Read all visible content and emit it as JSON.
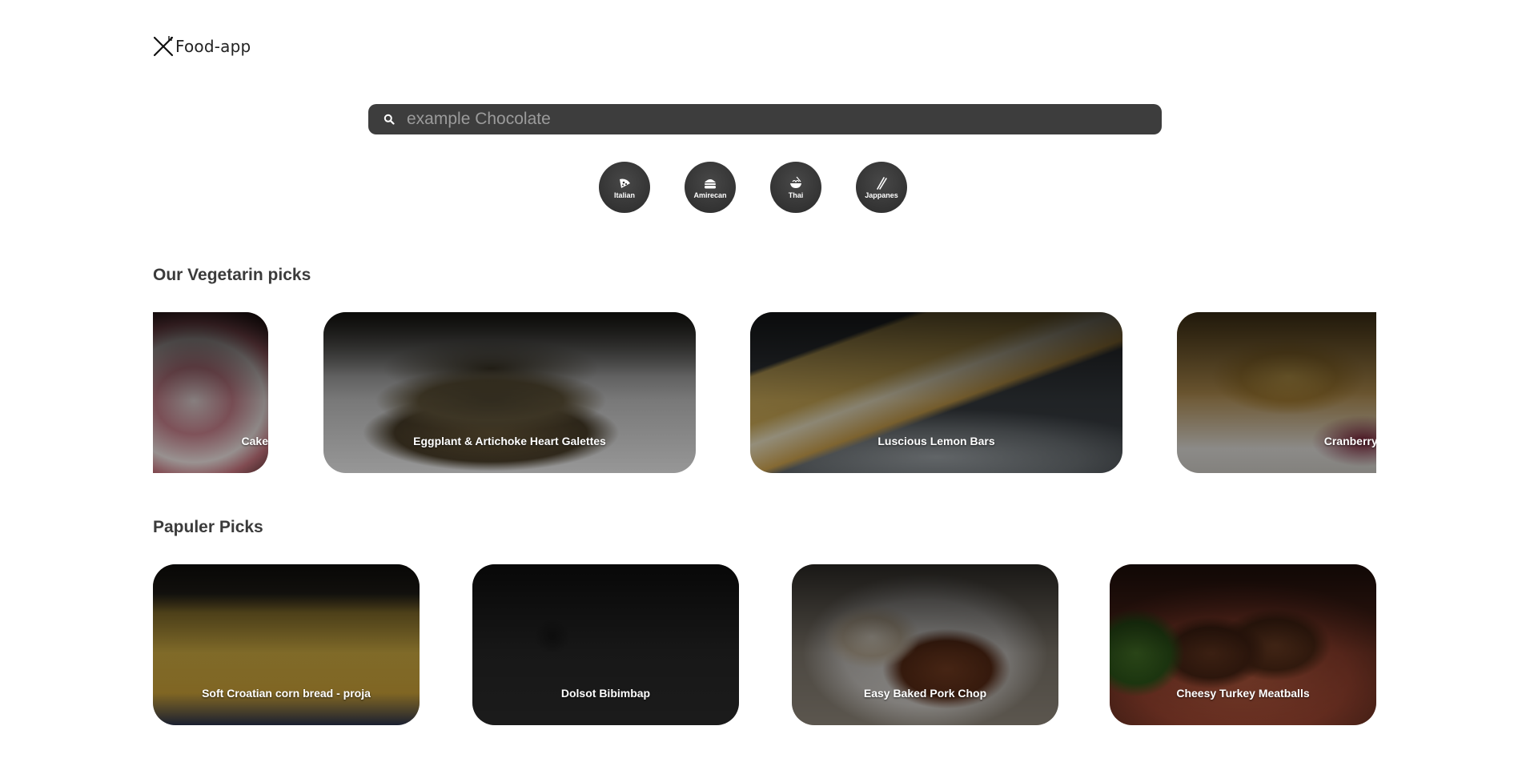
{
  "app": {
    "name": "Food-app",
    "logo_icon": "fork-knife-icon"
  },
  "search": {
    "placeholder": "example Chocolate",
    "value": "",
    "icon": "search-icon"
  },
  "cuisines": [
    {
      "label": "Italian",
      "icon": "pizza-icon"
    },
    {
      "label": "Amirecan",
      "icon": "burger-icon"
    },
    {
      "label": "Thai",
      "icon": "noodle-bowl-icon"
    },
    {
      "label": "Jappanes",
      "icon": "chopsticks-icon"
    }
  ],
  "vegetarian": {
    "title": "Our Vegetarin picks",
    "items": [
      {
        "label": "Cake"
      },
      {
        "label": "Eggplant & Artichoke Heart Galettes"
      },
      {
        "label": "Luscious Lemon Bars"
      },
      {
        "label": "Cranberry App"
      }
    ]
  },
  "popular": {
    "title": "Papuler Picks",
    "items": [
      {
        "label": "Soft Croatian corn bread - proja"
      },
      {
        "label": "Dolsot Bibimbap"
      },
      {
        "label": "Easy Baked Pork Chop"
      },
      {
        "label": "Cheesy Turkey Meatballs"
      }
    ]
  },
  "colors": {
    "search_bg": "#3d3d3d",
    "chip_bg": "#333333",
    "text": "#3b3b3b"
  }
}
